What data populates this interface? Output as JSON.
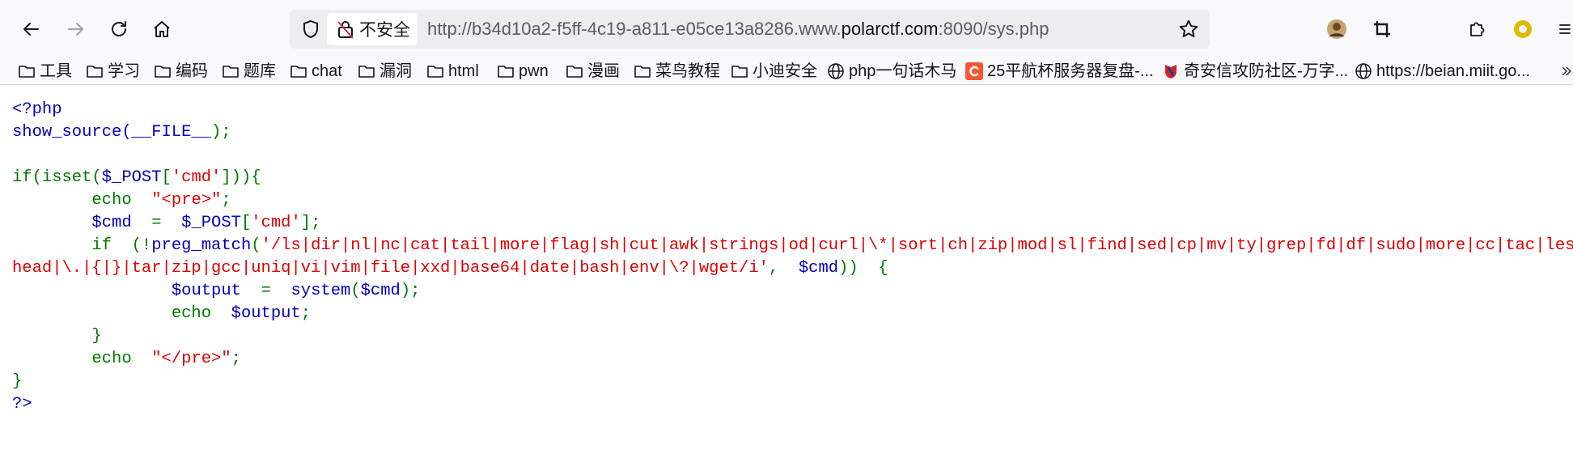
{
  "toolbar": {
    "back_icon": "arrow-left-icon",
    "forward_icon": "arrow-right-icon",
    "reload_icon": "reload-icon",
    "home_icon": "home-icon"
  },
  "urlbar": {
    "security_label": "不安全",
    "url_prefix": "http://b34d10a2-f5ff-4c19-a811-e05ce13a8286.www.",
    "url_domain": "polarctf.com",
    "url_suffix": ":8090/sys.php"
  },
  "bookmarks": [
    {
      "label": "工具",
      "icon": "folder-icon"
    },
    {
      "label": "学习",
      "icon": "folder-icon"
    },
    {
      "label": "编码",
      "icon": "folder-icon"
    },
    {
      "label": "题库",
      "icon": "folder-icon"
    },
    {
      "label": "chat",
      "icon": "folder-icon"
    },
    {
      "label": "漏洞",
      "icon": "folder-icon"
    },
    {
      "label": "html",
      "icon": "folder-icon"
    },
    {
      "label": "pwn",
      "icon": "folder-icon"
    },
    {
      "label": "漫画",
      "icon": "folder-icon"
    },
    {
      "label": "菜鸟教程",
      "icon": "folder-icon"
    },
    {
      "label": "小迪安全",
      "icon": "folder-icon"
    },
    {
      "label": "php一句话木马",
      "icon": "globe-icon"
    },
    {
      "label": "25平航杯服务器复盘-...",
      "icon": "csdn-logo-icon"
    },
    {
      "label": "奇安信攻防社区-万字...",
      "icon": "qianxin-logo-icon"
    },
    {
      "label": "https://beian.miit.go...",
      "icon": "globe-icon"
    }
  ],
  "code": {
    "l1": "<?php",
    "l2a": "show_source(",
    "l2b": "__FILE__",
    "l2c": ");",
    "l4a": "if(isset(",
    "l4b": "$_POST",
    "l4c": "[",
    "l4d": "'cmd'",
    "l4e": "])){",
    "l5a": "        echo  ",
    "l5b": "\"<pre>\"",
    "l5c": ";",
    "l6a": "        ",
    "l6b": "$cmd",
    "l6c": "  =  ",
    "l6d": "$_POST",
    "l6e": "[",
    "l6f": "'cmd'",
    "l6g": "];",
    "l7a": "        if  (!",
    "l7b": "preg_match",
    "l7c": "(",
    "l7d": "'/ls|dir|nl|nc|cat|tail|more|flag|sh|cut|awk|strings|od|curl|\\*|sort|ch|zip|mod|sl|find|sed|cp|mv|ty|grep|fd|df|sudo|more|cc|tac|less|",
    "l8a": "head|\\.|{|}|tar|zip|gcc|uniq|vi|vim|file|xxd|base64|date|bash|env|\\?|wget/i'",
    "l8b": ",  ",
    "l8c": "$cmd",
    "l8d": "))  {",
    "l9a": "                ",
    "l9b": "$output",
    "l9c": "  =  ",
    "l9d": "system",
    "l9e": "(",
    "l9f": "$cmd",
    "l9g": ");",
    "l10a": "                echo  ",
    "l10b": "$output",
    "l10c": ";",
    "l11": "        }",
    "l12a": "        echo  ",
    "l12b": "\"</pre>\"",
    "l12c": ";",
    "l13": "}",
    "l14": "?>"
  },
  "colors": {
    "php_default": "#0000bb",
    "php_keyword": "#007700",
    "php_string": "#dd0000",
    "toolbar_bg": "#f9f9fb",
    "urlbar_bg": "#ededf0"
  }
}
